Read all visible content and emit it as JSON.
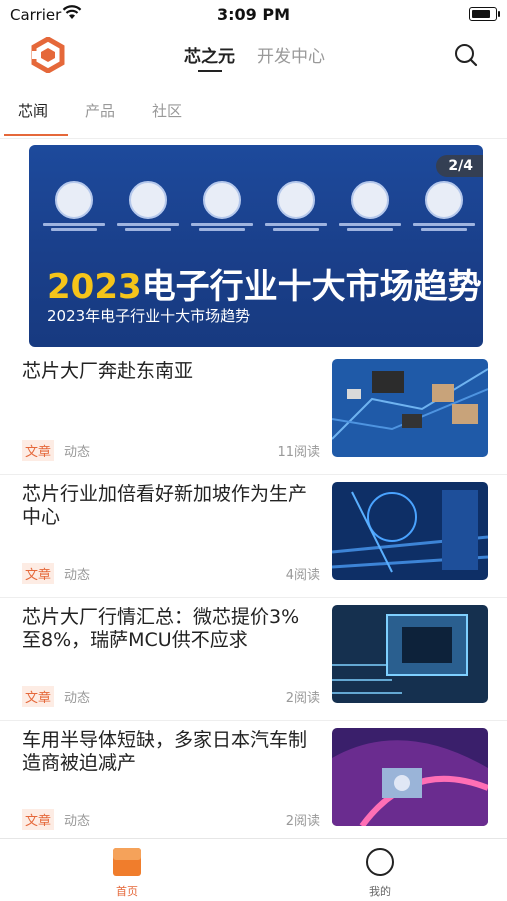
{
  "status_bar": {
    "carrier": "Carrier",
    "time": "3:09 PM"
  },
  "header": {
    "tabs": [
      {
        "label": "芯之元",
        "active": true
      },
      {
        "label": "开发中心",
        "active": false
      }
    ],
    "logo_icon": "brand-logo-icon",
    "search_icon": "search-icon"
  },
  "subtabs": [
    {
      "label": "芯闻",
      "active": true
    },
    {
      "label": "产品",
      "active": false
    },
    {
      "label": "社区",
      "active": false
    }
  ],
  "banner": {
    "year": "2023",
    "headline_rest": "电子行业十大市场趋势",
    "subtitle": "2023年电子行业十大市场趋势",
    "pager": "2/4"
  },
  "articles": [
    {
      "title": "芯片大厂奔赴东南亚",
      "tag": "文章",
      "category": "动态",
      "reads": "11阅读"
    },
    {
      "title": "芯片行业加倍看好新加坡作为生产中心",
      "tag": "文章",
      "category": "动态",
      "reads": "4阅读"
    },
    {
      "title": "芯片大厂行情汇总：微芯提价3%至8%，瑞萨MCU供不应求",
      "tag": "文章",
      "category": "动态",
      "reads": "2阅读"
    },
    {
      "title": "车用半导体短缺，多家日本汽车制造商被迫减产",
      "tag": "文章",
      "category": "动态",
      "reads": "2阅读"
    }
  ],
  "tabbar": [
    {
      "label": "首页",
      "active": true,
      "icon": "home-icon"
    },
    {
      "label": "我的",
      "active": false,
      "icon": "profile-icon"
    }
  ],
  "colors": {
    "accent": "#e5683a",
    "banner_bg": "#1d4a9c",
    "banner_year": "#f5c41a"
  }
}
